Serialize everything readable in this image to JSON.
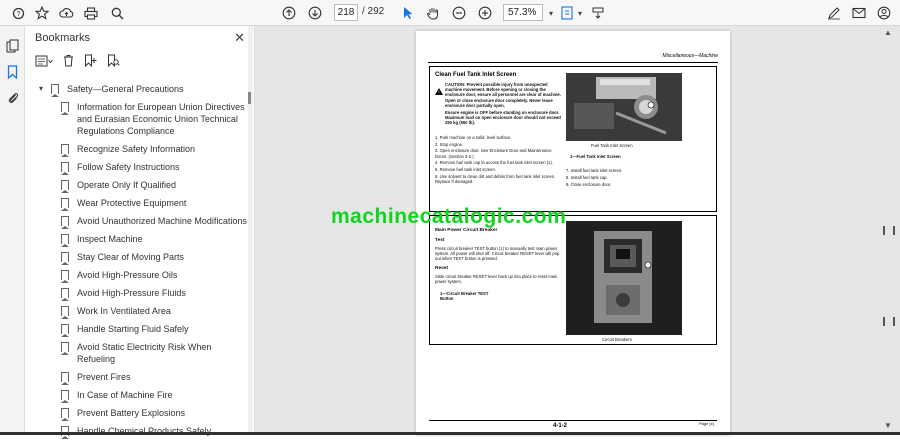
{
  "toolbar": {
    "page_current": "218",
    "page_total": "/ 292",
    "zoom": "57.3%"
  },
  "panel": {
    "title": "Bookmarks",
    "items": [
      {
        "label": "Safety—General Precautions",
        "level": 0
      },
      {
        "label": "Information for European Union Directives and Eurasian Economic Union Technical Regulations Compliance",
        "level": 1
      },
      {
        "label": "Recognize Safety Information",
        "level": 1
      },
      {
        "label": "Follow Safety Instructions",
        "level": 1
      },
      {
        "label": "Operate Only If Qualified",
        "level": 1
      },
      {
        "label": "Wear Protective Equipment",
        "level": 1
      },
      {
        "label": "Avoid Unauthorized Machine Modifications",
        "level": 1
      },
      {
        "label": "Inspect Machine",
        "level": 1
      },
      {
        "label": "Stay Clear of Moving Parts",
        "level": 1
      },
      {
        "label": "Avoid High-Pressure Oils",
        "level": 1
      },
      {
        "label": "Avoid High-Pressure Fluids",
        "level": 1
      },
      {
        "label": "Work In Ventilated Area",
        "level": 1
      },
      {
        "label": "Handle Starting Fluid Safely",
        "level": 1
      },
      {
        "label": "Avoid Static Electricity Risk When Refueling",
        "level": 1
      },
      {
        "label": "Prevent Fires",
        "level": 1
      },
      {
        "label": "In Case of Machine Fire",
        "level": 1
      },
      {
        "label": "Prevent Battery Explosions",
        "level": 1
      },
      {
        "label": "Handle Chemical Products Safely",
        "level": 1
      }
    ]
  },
  "doc": {
    "runhead": "Miscellaneous—Machine",
    "sec1_title": "Clean Fuel Tank Inlet Screen",
    "caution": "CAUTION: Prevent possible injury from unexpected machine movement. Before opening or closing the enclosure door, ensure all personnel are clear of machine. Open or close enclosure door completely. Never leave enclosure door partially open.",
    "caution2": "Ensure engine is OFF before standing on enclosure door. Maximum load on open enclosure door should not exceed 250 kg (550 lb).",
    "steps": [
      "1. Park machine on a solid, level surface.",
      "2. Stop engine.",
      "3. Open enclosure door. See Enclosure Door and Maintenance Doors. (Section 3-2.)",
      "4. Remove fuel tank cap to access the fuel tank inlet screen (1).",
      "5. Remove fuel tank inlet screen.",
      "6. Use solvent to clean dirt and debris from fuel tank inlet screen. Replace if damaged."
    ],
    "steps_right": [
      "7. Install fuel tank inlet screen.",
      "8. Install fuel tank cap.",
      "9. Close enclosure door."
    ],
    "photo1_caption": "Fuel Tank Inlet Screen",
    "photo1_legend": "1—Fuel Tank Inlet Screen",
    "sec2_subtitle": "Main Power Circuit Breaker",
    "sec2_test_head": "Test",
    "sec2_test": "Press circuit breaker TEST button (1) to manually test main power system. All power will shut off. Circuit breaker RESET lever will pop out when TEST button is pressed.",
    "sec2_reset_head": "Reset",
    "sec2_reset": "Slide circuit breaker RESET lever back up into place to reset main power system.",
    "sec2_legend": "1—Circuit Breaker TEST Button",
    "photo2_caption": "Circuit Breakers",
    "page_number": "4-1-2",
    "footer_right": "Page [x]"
  },
  "watermark": "machinecatalogic.com"
}
